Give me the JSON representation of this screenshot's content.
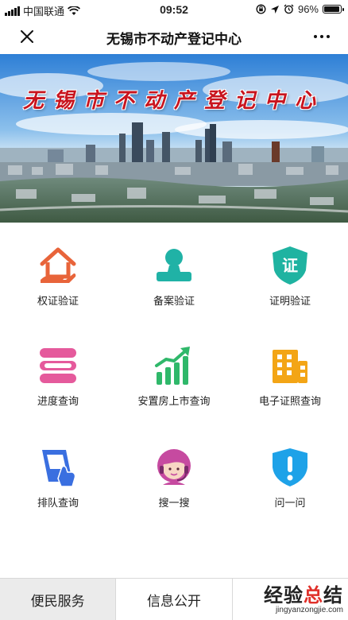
{
  "status_bar": {
    "carrier": "中国联通",
    "time": "09:52",
    "battery": "96%",
    "battery_level": 0.96
  },
  "header": {
    "title": "无锡市不动产登记中心"
  },
  "banner": {
    "title": "无锡市不动产登记中心"
  },
  "grid": {
    "items": [
      {
        "label": "权证验证",
        "icon": "house-hand-icon",
        "color": "#e8643a"
      },
      {
        "label": "备案验证",
        "icon": "stamp-icon",
        "color": "#20b2a6"
      },
      {
        "label": "证明验证",
        "icon": "certificate-shield-icon",
        "color": "#1fb3a1"
      },
      {
        "label": "进度查询",
        "icon": "progress-bars-icon",
        "color": "#e55a9c"
      },
      {
        "label": "安置房上市查询",
        "icon": "trend-chart-icon",
        "color": "#2fb86a"
      },
      {
        "label": "电子证照查询",
        "icon": "building-icon",
        "color": "#f3a516"
      },
      {
        "label": "排队查询",
        "icon": "queue-ticket-icon",
        "color": "#3a6fe0"
      },
      {
        "label": "搜一搜",
        "icon": "customer-service-icon",
        "color": "#c64aa0"
      },
      {
        "label": "问一问",
        "icon": "alert-shield-icon",
        "color": "#1ea2e8"
      }
    ]
  },
  "tabs": [
    {
      "label": "便民服务",
      "active": true
    },
    {
      "label": "信息公开",
      "active": false
    }
  ],
  "watermark": {
    "main_a": "经验",
    "main_b": "总",
    "main_c": "结",
    "url": "jingyanzongjie.com"
  }
}
